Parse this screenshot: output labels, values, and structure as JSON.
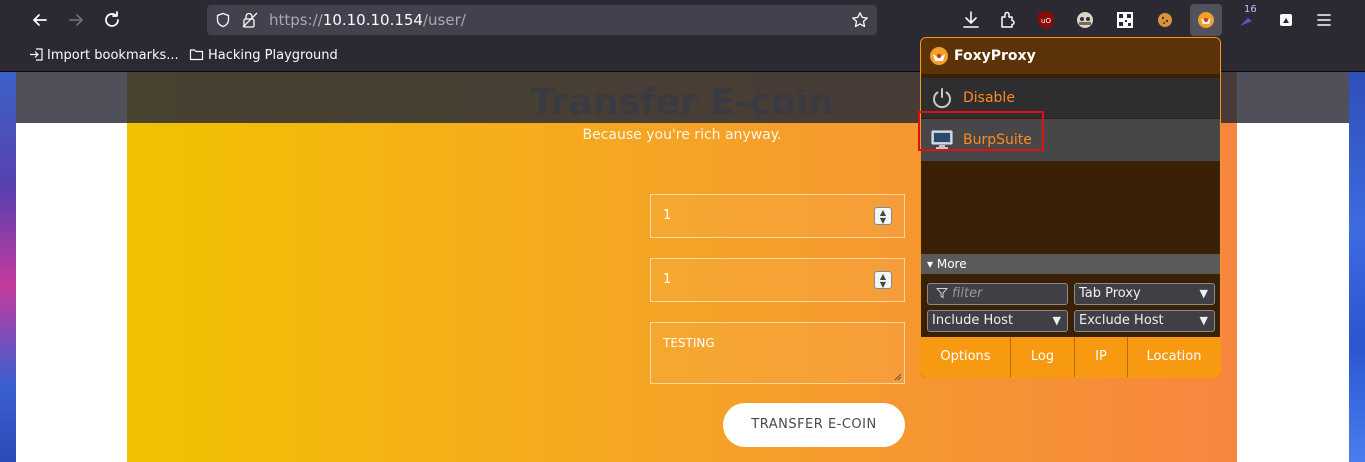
{
  "browser": {
    "url_prefix": "https://",
    "url_host": "10.10.10.154",
    "url_path": "/user/",
    "badge_count": "16"
  },
  "bookmarks": [
    {
      "label": "Import bookmarks...",
      "icon": "import-icon"
    },
    {
      "label": "Hacking Playground",
      "icon": "folder-icon"
    }
  ],
  "page": {
    "title": "Transfer E-coin",
    "subtitle": "Because you're rich anyway.",
    "field_1_value": "1",
    "field_2_value": "1",
    "message_value": "TESTING",
    "submit_label": "TRANSFER E-COIN",
    "gradient_colors": [
      "#f2c200",
      "#f5a623",
      "#f7863f"
    ]
  },
  "foxyproxy": {
    "title": "FoxyProxy",
    "disable_label": "Disable",
    "proxy_label": "BurpSuite",
    "more_label": "▾ More",
    "filter_placeholder": "filter",
    "tab_proxy": "Tab Proxy",
    "include_host": "Include Host",
    "exclude_host": "Exclude Host",
    "buttons": [
      "Options",
      "Log",
      "IP",
      "Location"
    ],
    "accent": "#f79a12",
    "highlight_color": "#e01010"
  }
}
